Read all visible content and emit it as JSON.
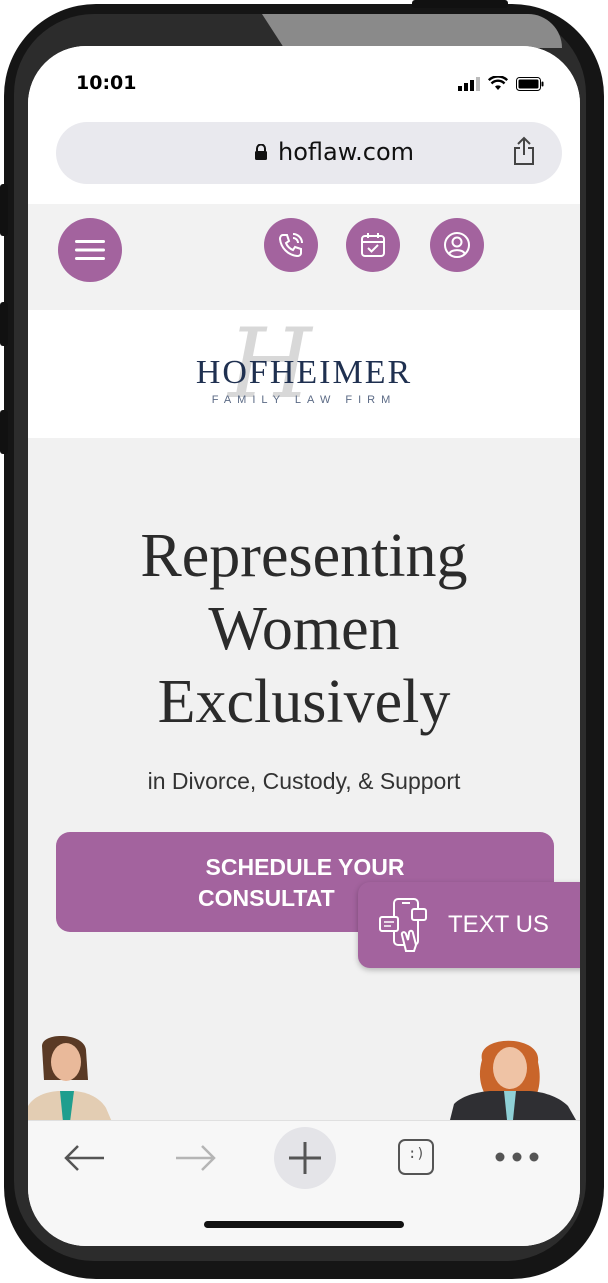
{
  "status_bar": {
    "time": "10:01"
  },
  "browser": {
    "url": "hoflaw.com"
  },
  "header": {
    "menu_icon": "hamburger-icon",
    "action_icons": [
      "phone-icon",
      "calendar-icon",
      "user-icon"
    ],
    "accent_color": "#a3639e"
  },
  "logo": {
    "name": "HOFHEIMER",
    "tagline": "FAMILY LAW FIRM"
  },
  "hero": {
    "title_lines": [
      "Representing",
      "Women",
      "Exclusively"
    ],
    "subtitle": "in Divorce, Custody, & Support",
    "cta_lines": [
      "SCHEDULE YOUR",
      "CONSULTAT"
    ],
    "text_us_label": "TEXT US"
  },
  "toolbar": {
    "icons": [
      "back-arrow-icon",
      "forward-arrow-icon",
      "plus-icon",
      "tabs-icon",
      "more-icon"
    ]
  }
}
